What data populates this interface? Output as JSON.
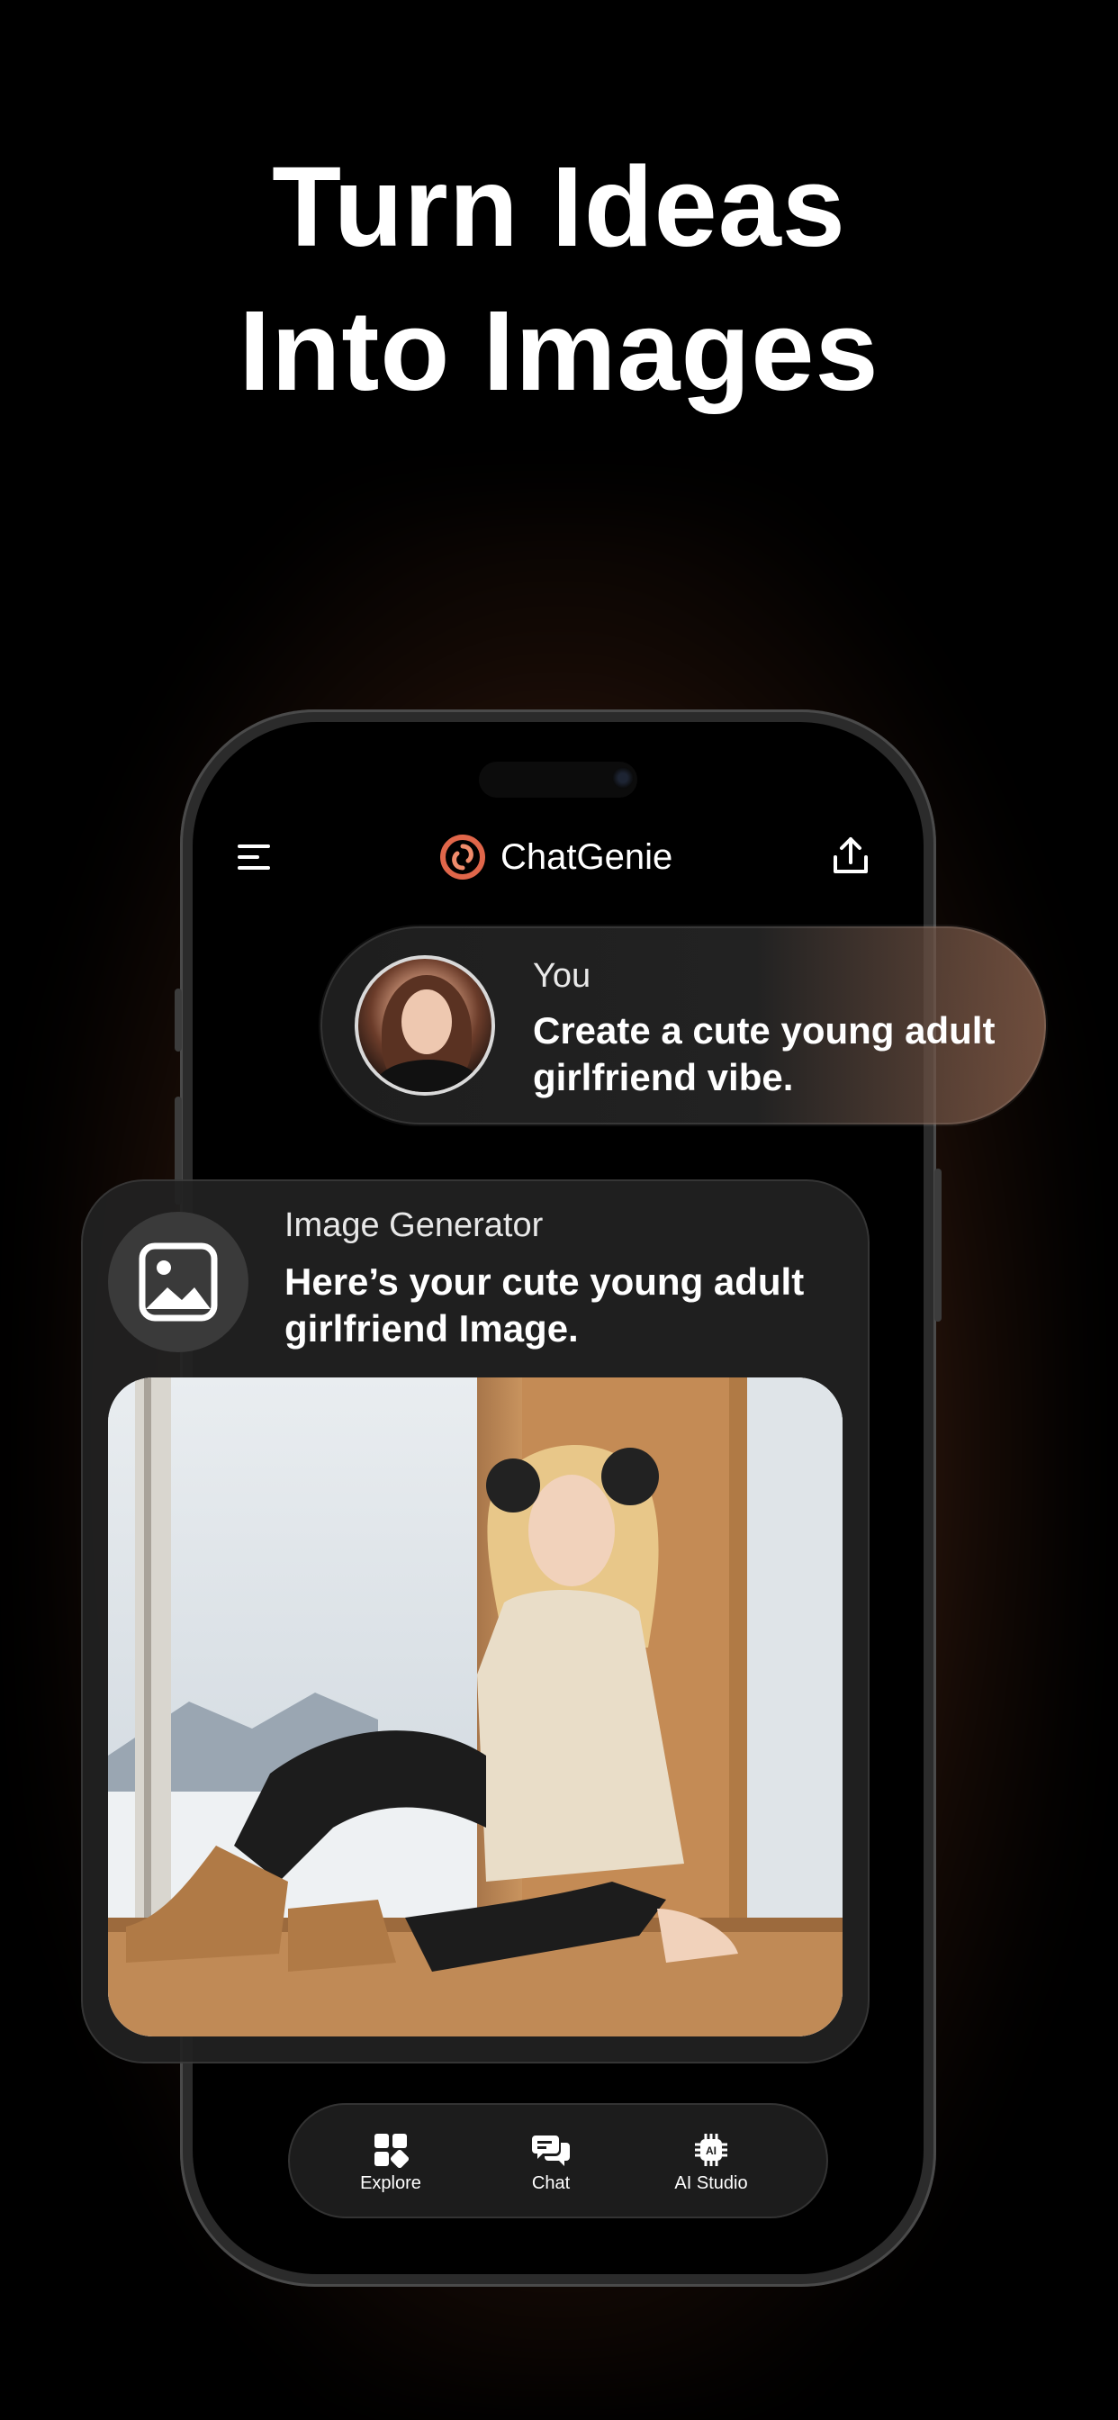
{
  "headline": {
    "line1": "Turn Ideas",
    "line2": "Into Images"
  },
  "app": {
    "brand_name": "ChatGenie",
    "menu_icon": "hamburger-menu-icon",
    "share_icon": "share-upload-icon",
    "brand_color": "#e0664a"
  },
  "user_message": {
    "sender": "You",
    "text_line1": "Create a cute young adult",
    "text_line2": "girlfriend vibe."
  },
  "generator_message": {
    "sender": "Image Generator",
    "text_line1": "Here’s your cute young adult",
    "text_line2": "girlfriend Image.",
    "icon": "image-icon"
  },
  "bottom_nav": {
    "items": [
      {
        "label": "Explore",
        "icon": "grid-icon"
      },
      {
        "label": "Chat",
        "icon": "chat-bubbles-icon"
      },
      {
        "label": "AI Studio",
        "icon": "ai-chip-icon"
      }
    ]
  }
}
